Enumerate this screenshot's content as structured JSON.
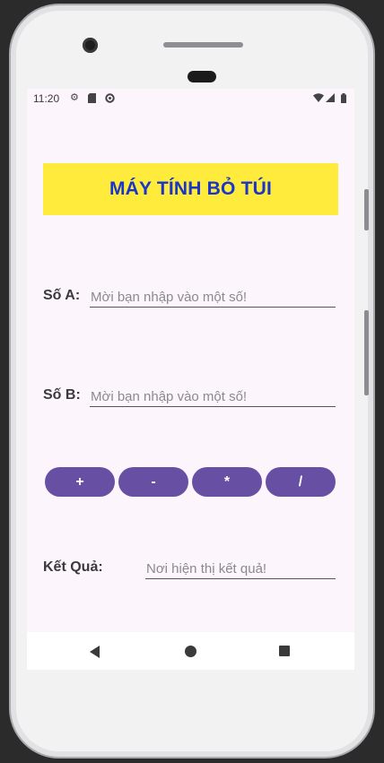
{
  "status_bar": {
    "time": "11:20",
    "left_icons": [
      "gear-icon",
      "sd-card-icon",
      "sync-icon"
    ],
    "right_icons": [
      "wifi-icon",
      "signal-icon",
      "battery-icon"
    ]
  },
  "app": {
    "title": "MÁY TÍNH BỎ TÚI",
    "number_a": {
      "label": "Số A:",
      "value": "",
      "placeholder": "Mời bạn nhập vào một số!"
    },
    "number_b": {
      "label": "Số B:",
      "value": "",
      "placeholder": "Mời bạn nhập vào một số!"
    },
    "operations": [
      {
        "label": "+"
      },
      {
        "label": "-"
      },
      {
        "label": "*"
      },
      {
        "label": "/"
      }
    ],
    "result": {
      "label": "Kết Quả:",
      "value": "",
      "placeholder": "Nơi hiện thị kết quả!"
    }
  },
  "colors": {
    "title_background": "#ffeb3b",
    "title_text": "#1a35c9",
    "button_background": "#6750a4",
    "screen_background": "#fdf5fc"
  }
}
